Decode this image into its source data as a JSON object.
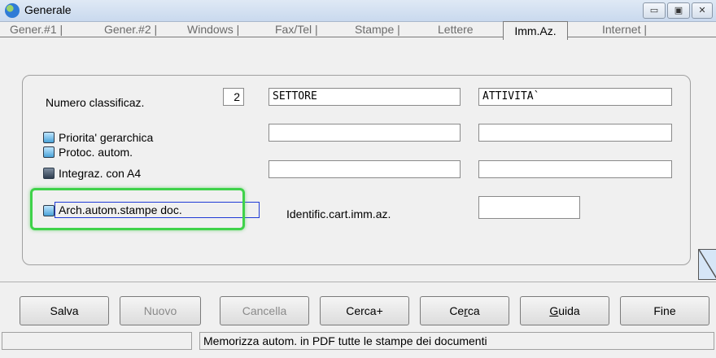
{
  "window": {
    "title": "Generale",
    "minimize_glyph": "▭",
    "maximize_glyph": "▣",
    "close_glyph": "✕"
  },
  "tabs": [
    {
      "label": "Gener.#1 |"
    },
    {
      "label": "Gener.#2 |"
    },
    {
      "label": "Windows |"
    },
    {
      "label": "Fax/Tel |"
    },
    {
      "label": "Stampe |"
    },
    {
      "label": "Lettere"
    },
    {
      "label": "Imm.Az."
    },
    {
      "label": "Internet |"
    }
  ],
  "active_tab": "Imm.Az.",
  "form": {
    "numero_label": "Numero classificaz.",
    "numero_value": "2",
    "settore_value": "SETTORE",
    "attivita_value": "ATTIVITA`",
    "field_r2_a": "",
    "field_r2_b": "",
    "field_r3_a": "",
    "field_r3_b": "",
    "identific_value": "",
    "priorita_label": "Priorita' gerarchica",
    "protoc_label": "Protoc. autom.",
    "integraz_label": "Integraz. con A4",
    "arch_label": "Arch.autom.stampe doc.",
    "identific_label": "Identific.cart.imm.az."
  },
  "buttons": {
    "salva": "Salva",
    "nuovo": "Nuovo",
    "cancella": "Cancella",
    "cerca_plus": "Cerca+",
    "cerca_pre": "Ce",
    "cerca_u": "r",
    "cerca_post": "ca",
    "guida_u": "G",
    "guida_post": "uida",
    "fine": "Fine"
  },
  "status": {
    "left": "",
    "message": "Memorizza autom. in PDF tutte le stampe dei documenti"
  },
  "colors": {
    "highlight": "#3fd24a",
    "focus": "#1f3bd6"
  },
  "icons": {
    "app": "globe-icon"
  }
}
